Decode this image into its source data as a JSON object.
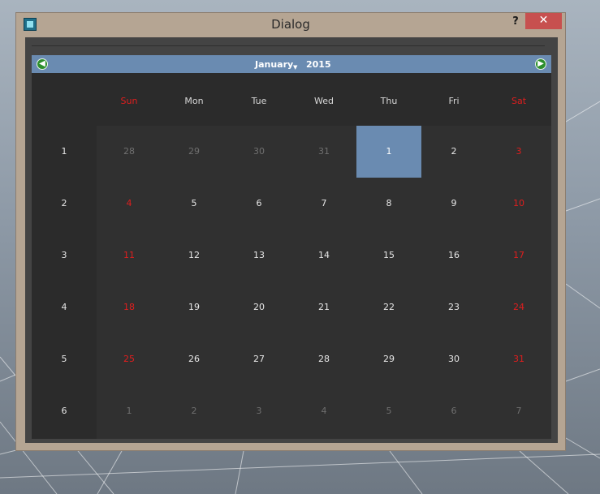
{
  "window": {
    "title": "Dialog",
    "help_label": "?",
    "close_label": "✕"
  },
  "icons": {
    "app": "app-icon",
    "prev": "arrow-left-icon",
    "next": "arrow-right-icon"
  },
  "nav": {
    "prev_glyph": "◀",
    "next_glyph": "▶",
    "month": "January",
    "year": "2015"
  },
  "headers": [
    "Sun",
    "Mon",
    "Tue",
    "Wed",
    "Thu",
    "Fri",
    "Sat"
  ],
  "week_numbers": [
    "1",
    "2",
    "3",
    "4",
    "5",
    "6"
  ],
  "weeks": [
    [
      "28",
      "29",
      "30",
      "31",
      "1",
      "2",
      "3"
    ],
    [
      "4",
      "5",
      "6",
      "7",
      "8",
      "9",
      "10"
    ],
    [
      "11",
      "12",
      "13",
      "14",
      "15",
      "16",
      "17"
    ],
    [
      "18",
      "19",
      "20",
      "21",
      "22",
      "23",
      "24"
    ],
    [
      "25",
      "26",
      "27",
      "28",
      "29",
      "30",
      "31"
    ],
    [
      "1",
      "2",
      "3",
      "4",
      "5",
      "6",
      "7"
    ]
  ],
  "selected_date": "2015-01-01",
  "colors": {
    "accent": "#6a8bb1",
    "weekend": "#e01e1e",
    "other_month": "#6f6f6f",
    "text": "#e6e6e6"
  }
}
